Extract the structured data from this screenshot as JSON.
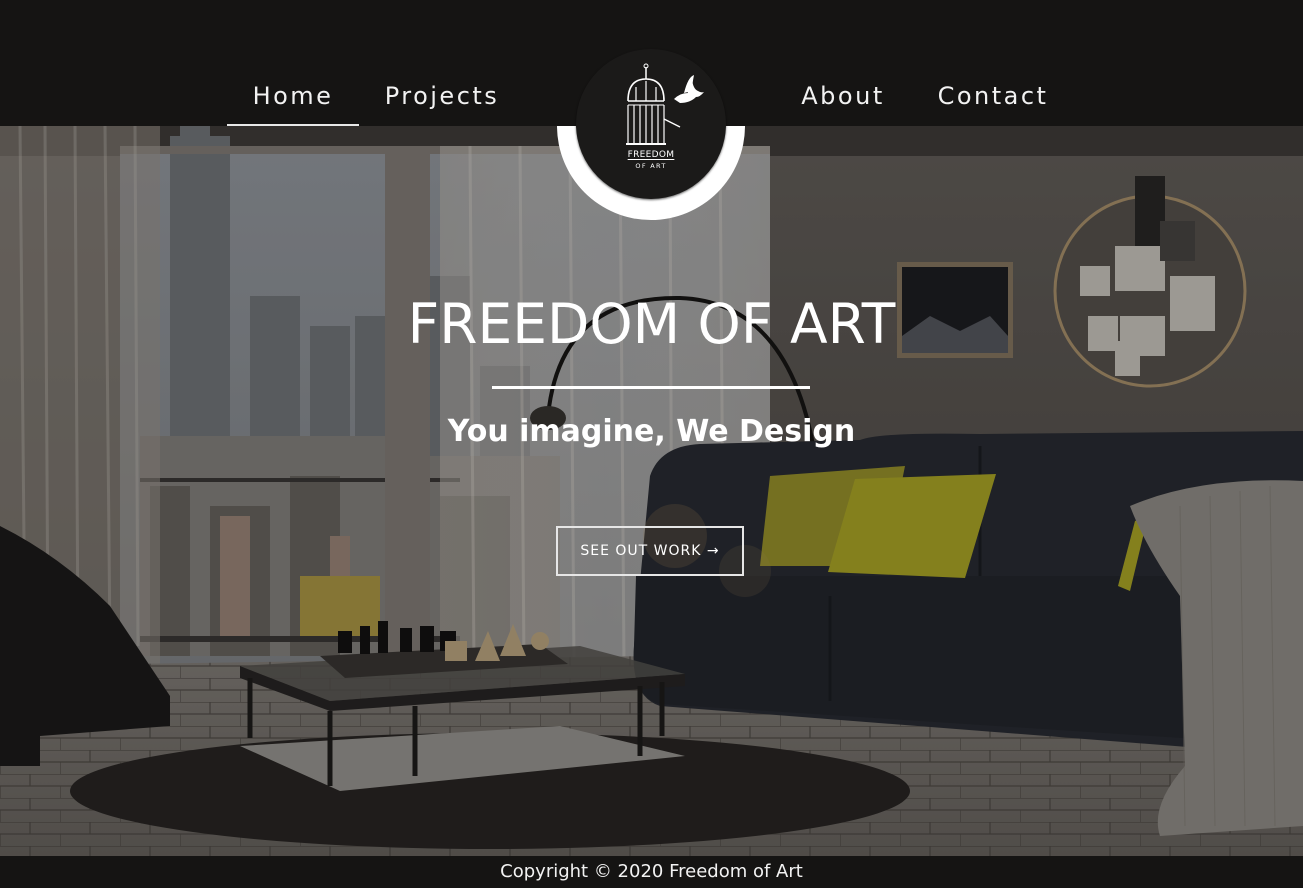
{
  "nav": {
    "home": "Home",
    "projects": "Projects",
    "about": "About",
    "contact": "Contact"
  },
  "logo": {
    "line1": "FREEDOM",
    "line2": "OF ART",
    "icon": "birdcage-with-bird-icon"
  },
  "hero": {
    "title": "FREEDOM OF ART",
    "subtitle": "You imagine, We Design",
    "cta_label": "SEE OUT WORK →",
    "background": "living-room-photo"
  },
  "footer": {
    "copyright": "Copyright © 2020 Freedom of Art"
  },
  "colors": {
    "header_bg": "#151413",
    "text": "#ffffff",
    "logo_ring": "#ffffff",
    "sofa_pillow": "#b8b229"
  }
}
